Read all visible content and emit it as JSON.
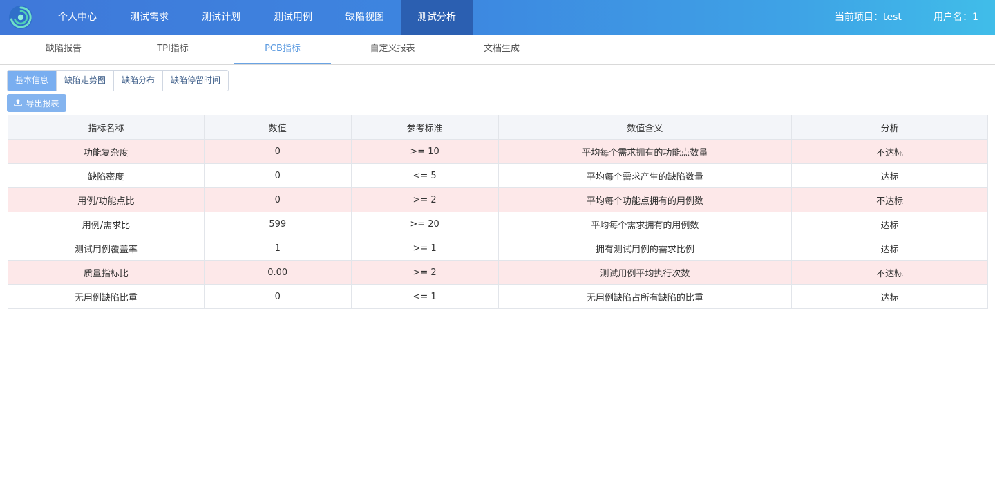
{
  "topnav": {
    "items": [
      "个人中心",
      "测试需求",
      "测试计划",
      "测试用例",
      "缺陷视图",
      "测试分析"
    ],
    "active_index": 5,
    "project": "当前项目：test",
    "user": "用户名：1"
  },
  "subtabs": {
    "items": [
      "缺陷报告",
      "TPI指标",
      "PCB指标",
      "自定义报表",
      "文档生成"
    ],
    "active_index": 2
  },
  "view_buttons": {
    "items": [
      "基本信息",
      "缺陷走势图",
      "缺陷分布",
      "缺陷停留时间"
    ],
    "active_index": 0
  },
  "export_button": {
    "label": "导出报表",
    "icon": "upload-icon"
  },
  "table": {
    "headers": [
      "指标名称",
      "数值",
      "参考标准",
      "数值含义",
      "分析"
    ],
    "rows": [
      {
        "name": "功能复杂度",
        "value": "0",
        "standard": ">= 10",
        "meaning": "平均每个需求拥有的功能点数量",
        "analysis": "不达标"
      },
      {
        "name": "缺陷密度",
        "value": "0",
        "standard": "<= 5",
        "meaning": "平均每个需求产生的缺陷数量",
        "analysis": "达标"
      },
      {
        "name": "用例/功能点比",
        "value": "0",
        "standard": ">= 2",
        "meaning": "平均每个功能点拥有的用例数",
        "analysis": "不达标"
      },
      {
        "name": "用例/需求比",
        "value": "599",
        "standard": ">= 20",
        "meaning": "平均每个需求拥有的用例数",
        "analysis": "达标"
      },
      {
        "name": "测试用例覆盖率",
        "value": "1",
        "standard": ">= 1",
        "meaning": "拥有测试用例的需求比例",
        "analysis": "达标"
      },
      {
        "name": "质量指标比",
        "value": "0.00",
        "standard": ">= 2",
        "meaning": "测试用例平均执行次数",
        "analysis": "不达标"
      },
      {
        "name": "无用例缺陷比重",
        "value": "0",
        "standard": "<= 1",
        "meaning": "无用例缺陷占所有缺陷的比重",
        "analysis": "达标"
      }
    ]
  },
  "colors": {
    "nav_gradient_start": "#3f78d9",
    "nav_gradient_end": "#40bde9",
    "nav_active": "#2b5fb1",
    "accent": "#5b9ae0",
    "fail_row": "#fde8e9",
    "header_bg": "#f3f5f9"
  }
}
